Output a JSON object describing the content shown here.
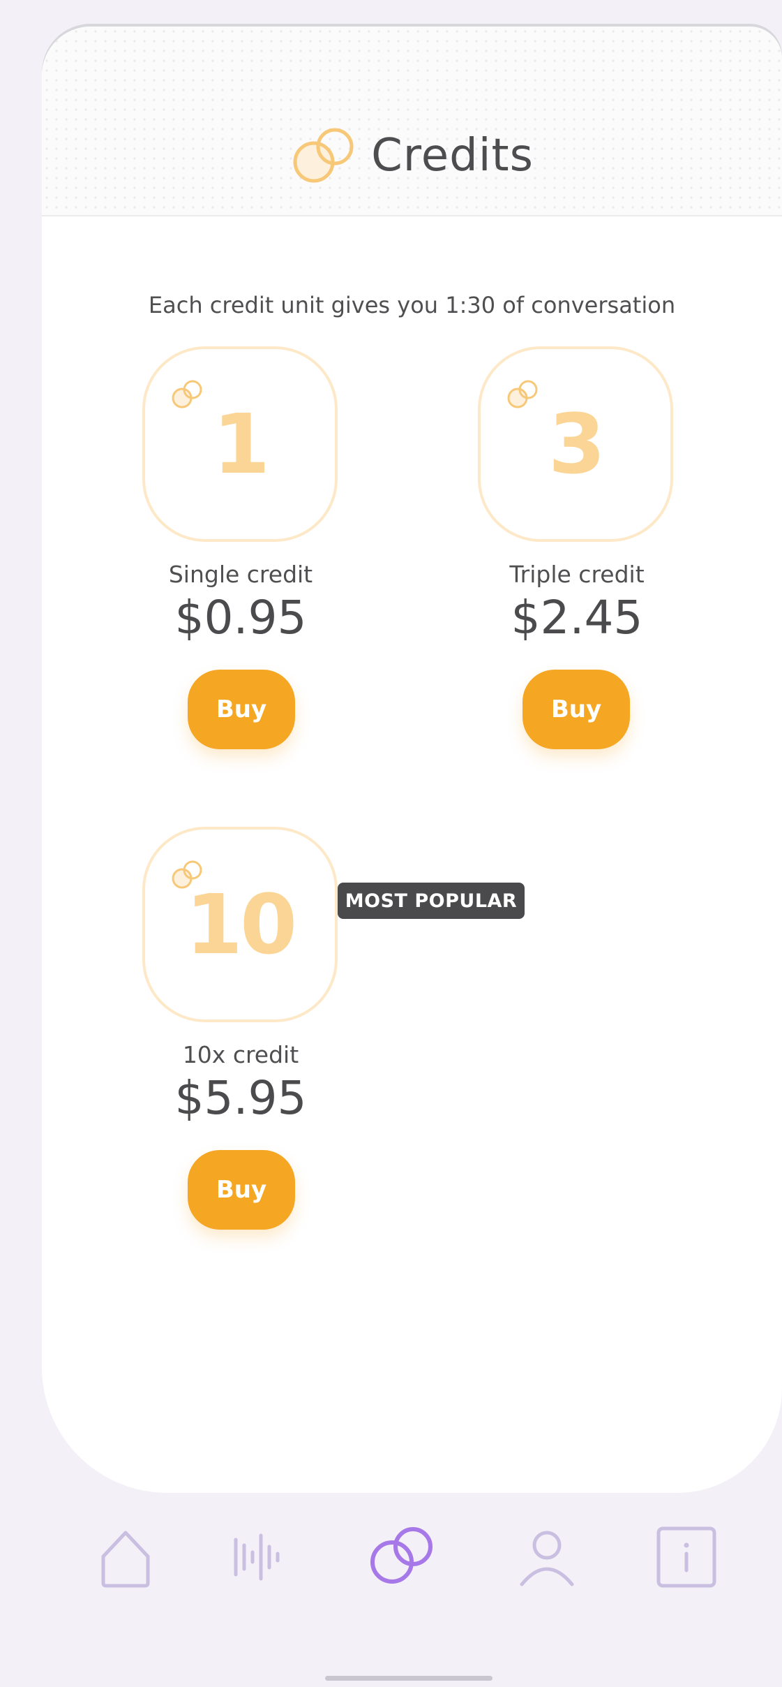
{
  "header": {
    "title": "Credits"
  },
  "subtitle": "Each credit unit gives you 1:30 of conversation",
  "packages": [
    {
      "count": "1",
      "name": "Single credit",
      "price": "$0.95",
      "buy_label": "Buy"
    },
    {
      "count": "3",
      "name": "Triple credit",
      "price": "$2.45",
      "buy_label": "Buy"
    },
    {
      "count": "10",
      "name": "10x credit",
      "price": "$5.95",
      "buy_label": "Buy",
      "badge": "MOST POPULAR"
    }
  ],
  "nav": {
    "items": [
      {
        "icon": "home-icon",
        "active": false
      },
      {
        "icon": "audio-wave-icon",
        "active": false
      },
      {
        "icon": "credits-icon",
        "active": true
      },
      {
        "icon": "profile-icon",
        "active": false
      },
      {
        "icon": "info-icon",
        "active": false
      }
    ]
  },
  "colors": {
    "accent": "#f5a623",
    "tile_number": "#fbd595",
    "nav_active": "#a678e8",
    "nav_inactive": "#c9bfe0"
  }
}
